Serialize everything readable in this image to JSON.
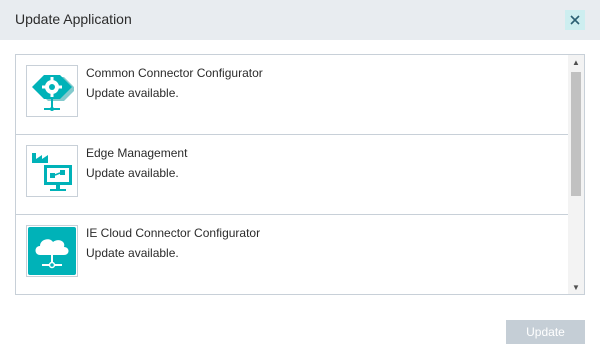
{
  "dialog": {
    "title": "Update Application",
    "close_icon": "close-icon",
    "update_button_label": "Update"
  },
  "apps": [
    {
      "name": "Common Connector Configurator",
      "status": "Update available.",
      "icon": "gear-connector-icon"
    },
    {
      "name": "Edge Management",
      "status": "Update available.",
      "icon": "edge-management-icon"
    },
    {
      "name": "IE Cloud Connector Configurator",
      "status": "Update available.",
      "icon": "cloud-network-icon"
    }
  ],
  "scrollbar": {
    "up_icon": "▲",
    "down_icon": "▼"
  },
  "colors": {
    "accent": "#00b2b8",
    "header_bg": "#e8ecf0",
    "disabled_button": "#c5ced6"
  }
}
